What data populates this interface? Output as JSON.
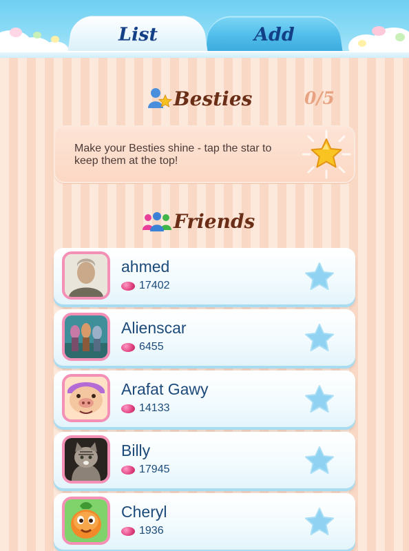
{
  "tabs": [
    {
      "label": "List",
      "active": true
    },
    {
      "label": "Add",
      "active": false
    }
  ],
  "besties": {
    "title": "Besties",
    "count": "0/5",
    "info": "Make your Besties shine - tap the star to keep them at the top!",
    "star_icon": "gold-star-icon"
  },
  "friends": {
    "title": "Friends",
    "items": [
      {
        "name": "ahmed",
        "score": "17402",
        "avatar": "photo-man"
      },
      {
        "name": "Alienscar",
        "score": "6455",
        "avatar": "photo-figures"
      },
      {
        "name": "Arafat Gawy",
        "score": "14133",
        "avatar": "pig-character"
      },
      {
        "name": "Billy",
        "score": "17945",
        "avatar": "photo-cat"
      },
      {
        "name": "Cheryl",
        "score": "1936",
        "avatar": "orange-candy-character"
      }
    ]
  },
  "colors": {
    "title_brown": "#6a2e17",
    "name_blue": "#1c4a7a",
    "star_blue": "#8fd2f2",
    "avatar_pink": "#f48fb6",
    "sky_blue": "#6fd0f2"
  }
}
